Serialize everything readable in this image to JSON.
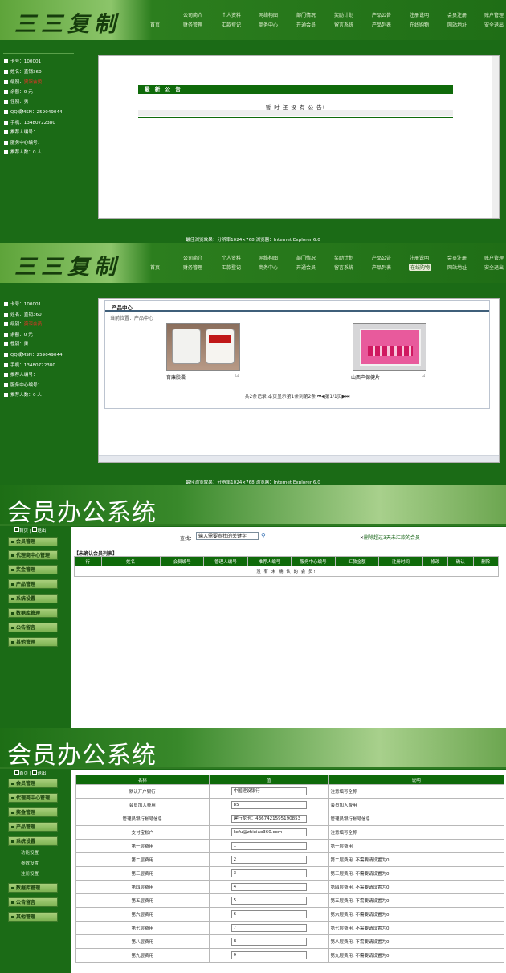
{
  "brand": {
    "logo_text": "三三复制",
    "system_title": "会员办公系统"
  },
  "nav_top": [
    "公司简介",
    "个人资料",
    "网络构图",
    "部门情况",
    "奖励计划",
    "产品公告",
    "注册说明",
    "会员注册",
    "账户管理"
  ],
  "nav_bottom": [
    "首页",
    "财务管理",
    "汇款登记",
    "商务中心",
    "开通会员",
    "留言系统",
    "产品列表",
    "在线购物",
    "网站地址",
    "安全退出"
  ],
  "member": {
    "card": "卡号：100001",
    "name": "姓名：直销360",
    "level": "级别：",
    "level_value": "资深会员",
    "balance": "余额：0 元",
    "gender": "性别：男",
    "qq": "QQ或MSN：259049044",
    "phone": "手机：13480722380",
    "referrer": "推荐人编号：",
    "service_center": "服务中心编号：",
    "referral_count": "推荐人数：0 人"
  },
  "announcement": {
    "title": "最 新 公 告",
    "empty": "暂 时 还 没 有 公 告!"
  },
  "footer": "最佳浏览效果：分辨率1024×768 浏览器：Internet Explorer 6.0",
  "products": {
    "title": "产品中心",
    "breadcrumb": "当前位置：产品中心",
    "items": [
      {
        "name": "育康胶囊"
      },
      {
        "name": "山西产保健片"
      }
    ],
    "pager": "共2条记录 本页显示第1条到第2条 ⏮◀第1/1页▶⏭"
  },
  "admin_menu": {
    "home": "首页",
    "logout": "退出",
    "items": [
      "会员管理",
      "代理商中心管理",
      "奖金管理",
      "产品管理",
      "系统设置",
      "数据库管理",
      "公告留言",
      "其他管理"
    ],
    "system_sub": [
      "功能设置",
      "参数设置",
      "注册设置"
    ]
  },
  "unconfirmed": {
    "search_label": "查找：",
    "search_placeholder": "输入需要查找的关键字",
    "delete_link": "删除超过3天未汇款的会员",
    "heading": "【未确认会员列表】",
    "columns": [
      "行",
      "姓名",
      "会员编号",
      "管理人编号",
      "推荐人编号",
      "服务中心编号",
      "汇款金额",
      "注册时间",
      "修改",
      "确认",
      "删除"
    ],
    "empty": "没 有 未 确 认 的 会 员!"
  },
  "settings": {
    "columns": [
      "名称",
      "值",
      "说明"
    ],
    "rows": [
      {
        "name": "默认开户银行",
        "value": "中国建设银行",
        "desc": "注意填写全称"
      },
      {
        "name": "会员加入费用",
        "value": "85",
        "desc": "会员加入费用"
      },
      {
        "name": "管理员银行帐号信息",
        "value": "建行龙卡：4367421595190853",
        "desc": "管理员银行帐号信息"
      },
      {
        "name": "支付宝帐户",
        "value": "kefu@zhixiao360.com",
        "desc": "注意填写全称"
      },
      {
        "name": "第一层费用",
        "value": "1",
        "desc": "第一层费用"
      },
      {
        "name": "第二层费用",
        "value": "2",
        "desc": "第二层费用, 不需要请设置为0"
      },
      {
        "name": "第三层费用",
        "value": "3",
        "desc": "第三层费用, 不需要请设置为0"
      },
      {
        "name": "第四层费用",
        "value": "4",
        "desc": "第四层费用, 不需要请设置为0"
      },
      {
        "name": "第五层费用",
        "value": "5",
        "desc": "第五层费用, 不需要请设置为0"
      },
      {
        "name": "第六层费用",
        "value": "6",
        "desc": "第六层费用, 不需要请设置为0"
      },
      {
        "name": "第七层费用",
        "value": "7",
        "desc": "第七层费用, 不需要请设置为0"
      },
      {
        "name": "第八层费用",
        "value": "8",
        "desc": "第八层费用, 不需要请设置为0"
      },
      {
        "name": "第九层费用",
        "value": "9",
        "desc": "第九层费用, 不需要请设置为0"
      }
    ]
  },
  "colors": {
    "brand_green": "#1b6b16",
    "header_green": "#0f6a0a",
    "accent_red": "#ff2a2a"
  }
}
